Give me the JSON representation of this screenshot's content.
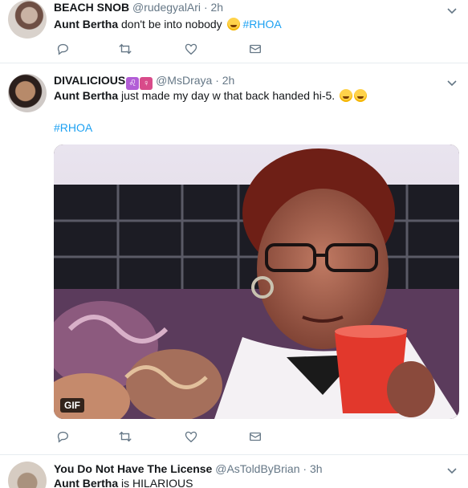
{
  "tweets": [
    {
      "name": "BEACH SNOB",
      "handle": "@rudegyalAri",
      "time": "· 2h",
      "bold_text": "Aunt Bertha",
      "text": " don't be into nobody",
      "hashtag": "#RHOA"
    },
    {
      "name": "DIVALICIOUS",
      "badge_1": "♌",
      "badge_2": "♀",
      "handle": "@MsDraya",
      "time": "· 2h",
      "bold_text": "Aunt Bertha",
      "text": " just made my day w that back handed hi-5.",
      "hashtag": "#RHOA",
      "media_badge": "GIF"
    },
    {
      "name": "You Do Not Have The License",
      "handle": "@AsToldByBrian",
      "time": "· 3h",
      "bold_text": "Aunt Bertha",
      "text": " is HILARIOUS"
    }
  ],
  "icons": {
    "reply": "reply-icon",
    "retweet": "retweet-icon",
    "like": "heart-icon",
    "dm": "envelope-icon",
    "menu": "chevron-down-icon"
  },
  "colors": {
    "accent": "#1da1f2",
    "muted": "#657786",
    "text": "#14171a",
    "divider": "#e6ecf0"
  }
}
